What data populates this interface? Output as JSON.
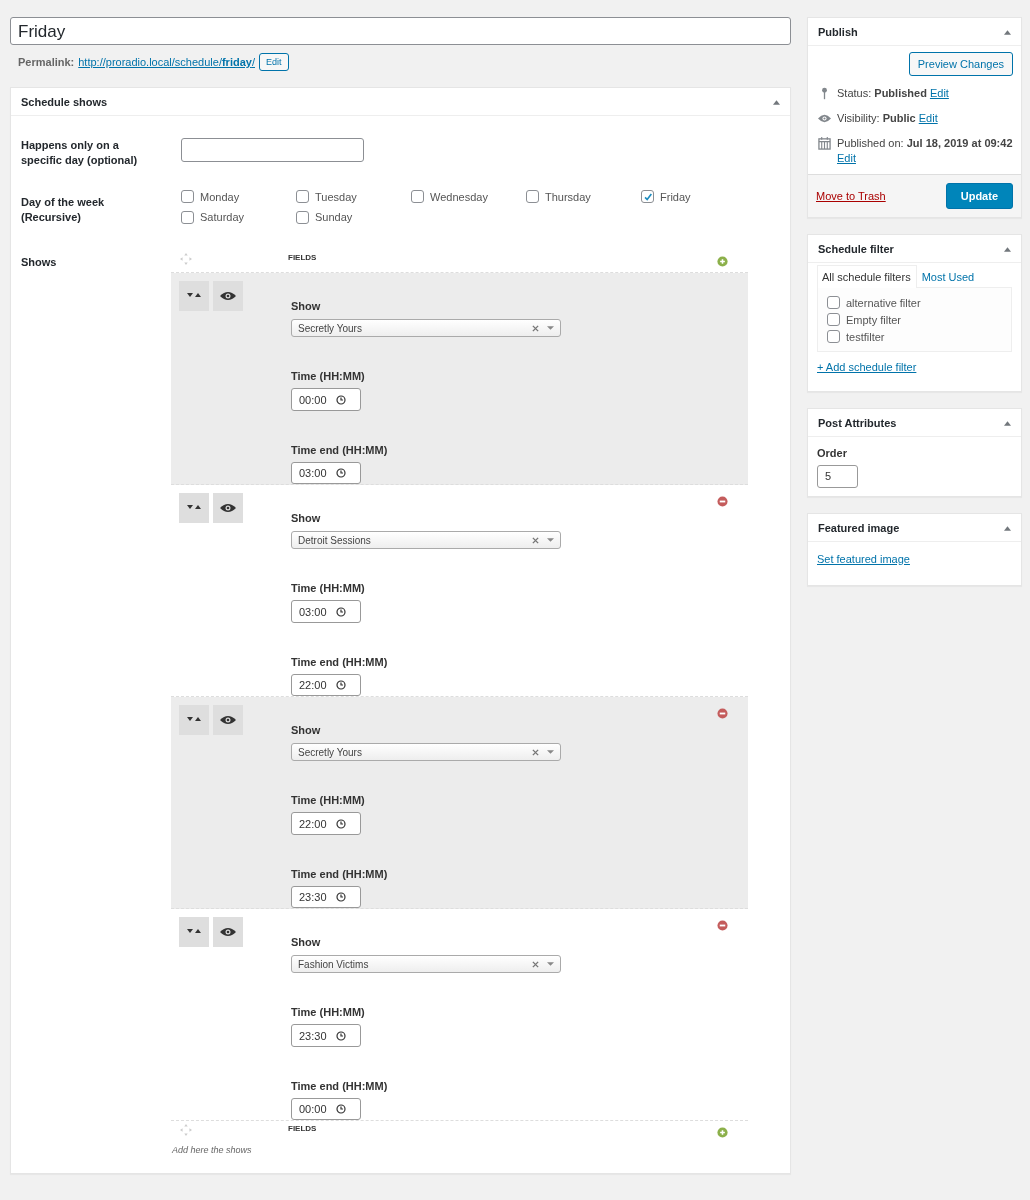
{
  "title": "Friday",
  "permalink": {
    "label": "Permalink:",
    "url": "http://proradio.local/schedule/**friday**/",
    "edit": "Edit"
  },
  "schedule_box": {
    "title": "Schedule shows",
    "specific_day": {
      "label": "Happens only on a specific day (optional)"
    },
    "days": {
      "label": "Day of the week (Recursive)",
      "items": [
        {
          "label": "Monday",
          "checked": false
        },
        {
          "label": "Tuesday",
          "checked": false
        },
        {
          "label": "Wednesday",
          "checked": false
        },
        {
          "label": "Thursday",
          "checked": false
        },
        {
          "label": "Friday",
          "checked": true
        },
        {
          "label": "Saturday",
          "checked": false
        },
        {
          "label": "Sunday",
          "checked": false
        }
      ]
    },
    "shows": {
      "label": "Shows",
      "header": "FIELDS",
      "footer": "FIELDS",
      "hint": "Add here the shows",
      "rows": [
        {
          "show_label": "Show",
          "show": "Secretly Yours",
          "time_label": "Time (HH:MM)",
          "time": "00:00",
          "end_label": "Time end (HH:MM)",
          "end": "03:00",
          "removable": false
        },
        {
          "show_label": "Show",
          "show": "Detroit Sessions",
          "time_label": "Time (HH:MM)",
          "time": "03:00",
          "end_label": "Time end (HH:MM)",
          "end": "22:00",
          "removable": true
        },
        {
          "show_label": "Show",
          "show": "Secretly Yours",
          "time_label": "Time (HH:MM)",
          "time": "22:00",
          "end_label": "Time end (HH:MM)",
          "end": "23:30",
          "removable": true
        },
        {
          "show_label": "Show",
          "show": "Fashion Victims",
          "time_label": "Time (HH:MM)",
          "time": "23:30",
          "end_label": "Time end (HH:MM)",
          "end": "00:00",
          "removable": true
        }
      ]
    }
  },
  "publish": {
    "title": "Publish",
    "preview": "Preview Changes",
    "meta": [
      {
        "kind": "status",
        "text": "Status: **Published**",
        "edit": "Edit"
      },
      {
        "kind": "visibility",
        "text": "Visibility: **Public**",
        "edit": "Edit"
      },
      {
        "kind": "date",
        "text": "Published on: **Jul 18, 2019 at 09:42**",
        "edit": "Edit"
      }
    ],
    "trash": "Move to Trash",
    "update": "Update"
  },
  "schedule_filter": {
    "title": "Schedule filter",
    "tabs": [
      {
        "label": "All schedule filters",
        "selected": true
      },
      {
        "label": "Most Used",
        "selected": false
      }
    ],
    "items": [
      {
        "label": "alternative filter",
        "checked": false
      },
      {
        "label": "Empty filter",
        "checked": false
      },
      {
        "label": "testfilter",
        "checked": false
      }
    ],
    "add": "+ Add schedule filter"
  },
  "post_attributes": {
    "title": "Post Attributes",
    "order_label": "Order",
    "order": "5"
  },
  "featured_image": {
    "title": "Featured image",
    "link": "Set featured image"
  }
}
